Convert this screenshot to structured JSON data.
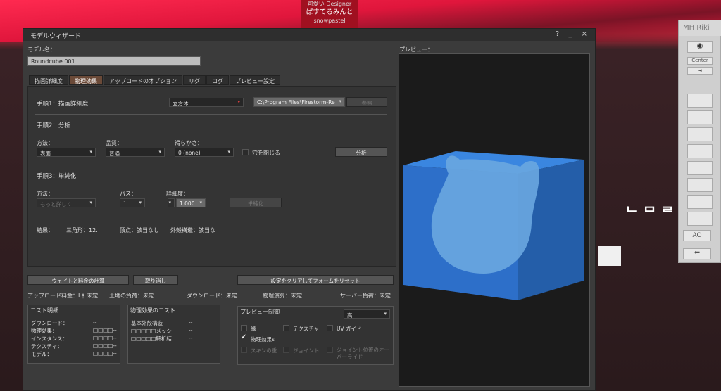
{
  "background": {
    "nametag": {
      "line1": "可愛い Designer",
      "line2": "ぱすてるみんと",
      "line3": "snowpastel"
    },
    "sign_text": "ᄅ ᄆ ᄀ"
  },
  "window": {
    "title": "モデルウィザード",
    "controls": "? _ ×",
    "model_name_label": "モデル名：",
    "model_name_value": "Roundcube 001",
    "tabs": [
      "描画詳細度",
      "物理効果",
      "アップロードのオプション",
      "リグ",
      "ログ",
      "プレビュー設定"
    ],
    "active_tab": "物理効果",
    "step1": {
      "title": "手順1：描画詳細度",
      "shape_select": "立方体",
      "path_value": "C:\\Program Files\\Firestorm-Re",
      "browse_button": "参照"
    },
    "step2": {
      "title": "手順2：分析",
      "method_label": "方法：",
      "method_value": "表面",
      "quality_label": "品質：",
      "quality_value": "普通",
      "smooth_label": "滑らかさ：",
      "smooth_value": "0 (none)",
      "close_holes_label": "穴を閉じる",
      "analyze_button": "分析"
    },
    "step3": {
      "title": "手順3：単純化",
      "method_label": "方法：",
      "method_value": "もっと詳しく",
      "pass_label": "パス：",
      "pass_value": "1",
      "detail_label": "詳細度：",
      "detail_value": "1.000",
      "simplify_button": "単純化"
    },
    "results": {
      "label": "結果：",
      "triangles": "三角形：12.",
      "vertices": "頂点：該当なし",
      "hull": "外殻構造：該当な"
    },
    "buttons": {
      "calc": "ウェイトと料金の計算",
      "cancel": "取り消し",
      "reset": "設定をクリアしてフォームをリセット"
    },
    "fees": {
      "upload": "アップロード料金：L$ 未定",
      "land": "土地の負荷：未定",
      "download": "ダウンロード：未定",
      "physics": "物理演算：未定",
      "server": "サーバー負荷：未定"
    },
    "cost_breakdown": {
      "title": "コスト明細",
      "rows": [
        {
          "label": "ダウンロード：",
          "value": "--"
        },
        {
          "label": "物理効果：",
          "value": "□□□□--"
        },
        {
          "label": "インスタンス：",
          "value": "□□□□--"
        },
        {
          "label": "テクスチャ：",
          "value": "□□□□--"
        },
        {
          "label": "モデル：",
          "value": "□□□□--"
        }
      ]
    },
    "physics_cost": {
      "title": "物理効果のコスト",
      "rows": [
        {
          "label": "基本外殻構造",
          "value": "--"
        },
        {
          "label": "□□□□□メッシ",
          "value": "--"
        },
        {
          "label": "□□□□□解析結",
          "value": "--"
        }
      ]
    },
    "preview_controls": {
      "title": "プレビュー制御",
      "select_value": "高",
      "edges": "縁",
      "texture": "テクスチャ",
      "uv_guide": "UV ガイド",
      "physics": "物理効果s",
      "skin_weight": "スキンの重",
      "joint": "ジョイント",
      "joint_override": "ジョイント位置のオーバーライド"
    },
    "preview_label": "プレビュー：",
    "colors": {
      "accent_tab": "#6b4a38",
      "cube": "#2d6fc9",
      "mesh": "#6aa7e0",
      "dropdown_arrow": "#e04040"
    }
  },
  "right_panel": {
    "title": "MH Riki",
    "center_label": "Center",
    "bottom_label": "AO"
  }
}
